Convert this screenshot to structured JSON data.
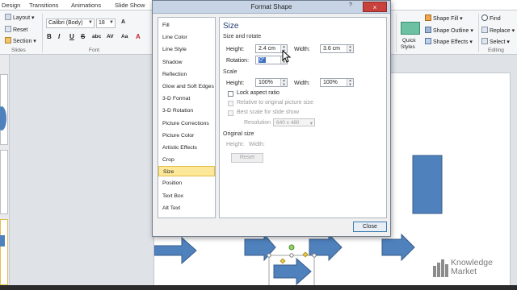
{
  "ribbon": {
    "tabs": [
      "Design",
      "Transitions",
      "Animations",
      "Slide Show"
    ],
    "slides_group": {
      "layout": "Layout",
      "reset": "Reset",
      "section": "Section",
      "label": "Slides"
    },
    "font_group": {
      "font_name": "Calibri (Body)",
      "font_size": "18",
      "bold": "B",
      "italic": "I",
      "underline": "U",
      "strike": "S",
      "shadow": "abc",
      "spacing": "AV",
      "change_case": "Aa",
      "label": "Font"
    },
    "drawing_group": {
      "quick_styles": "Quick",
      "quick_styles_2": "Styles",
      "shape_fill": "Shape Fill",
      "shape_outline": "Shape Outline",
      "shape_effects": "Shape Effects"
    },
    "editing_group": {
      "find": "Find",
      "replace": "Replace",
      "select": "Select",
      "label": "Editing"
    }
  },
  "dialog": {
    "title": "Format Shape",
    "help": "?",
    "close_x": "×",
    "nav_items": [
      "Fill",
      "Line Color",
      "Line Style",
      "Shadow",
      "Reflection",
      "Glow and Soft Edges",
      "3-D Format",
      "3-D Rotation",
      "Picture Corrections",
      "Picture Color",
      "Artistic Effects",
      "Crop",
      "Size",
      "Position",
      "Text Box",
      "Alt Text"
    ],
    "selected_nav": "Size",
    "panel": {
      "heading": "Size",
      "size_rotate_label": "Size and rotate",
      "height_label": "Height:",
      "height_value": "2.4 cm",
      "width_label": "Width:",
      "width_value": "3.6 cm",
      "rotation_label": "Rotation:",
      "rotation_value": "0°",
      "scale_label": "Scale",
      "scale_height_label": "Height:",
      "scale_height_value": "100%",
      "scale_width_label": "Width:",
      "scale_width_value": "100%",
      "lock_aspect": "Lock aspect ratio",
      "relative_original": "Relative to original picture size",
      "best_scale": "Best scale for slide show",
      "resolution_label": "Resolution",
      "resolution_value": "640 x 480",
      "original_size_label": "Original size",
      "original_height": "Height:",
      "original_width": "Width:",
      "reset_label": "Reset"
    },
    "close_button": "Close"
  },
  "watermark": {
    "line1": "Knowledge",
    "line2": "Market"
  }
}
